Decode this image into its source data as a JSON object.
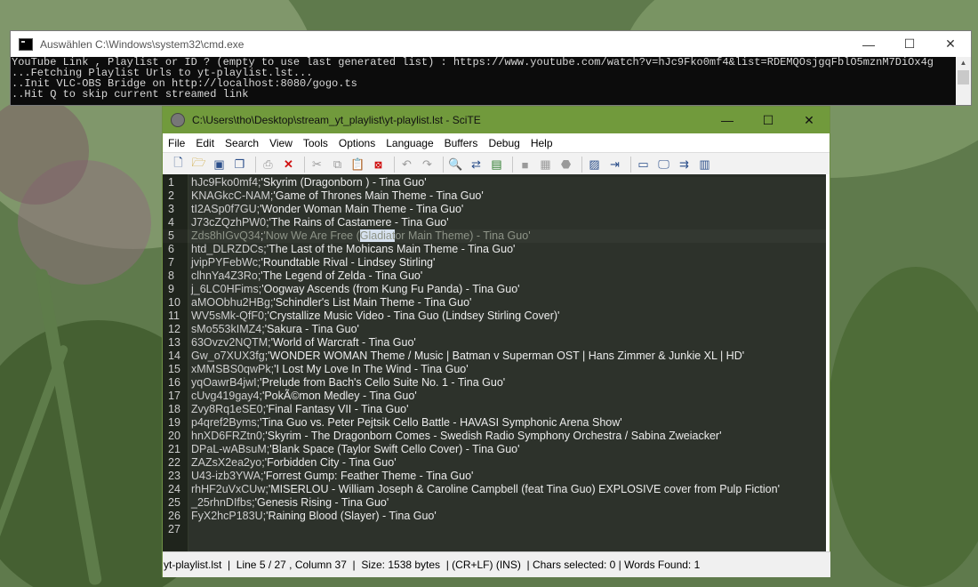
{
  "cmd": {
    "title": "Auswählen C:\\Windows\\system32\\cmd.exe",
    "lines": [
      "YouTube Link , Playlist or ID ? (empty to use last generated list) : https://www.youtube.com/watch?v=hJc9Fko0mf4&list=RDEMQOsjgqFblO5mznM7DiOx4g",
      "...Fetching Playlist Urls to yt-playlist.lst...",
      "..Init VLC-OBS Bridge on http://localhost:8080/gogo.ts",
      "..Hit Q to skip current streamed link"
    ],
    "minimize": "—",
    "maximize": "☐",
    "close": "✕"
  },
  "scite": {
    "title": "C:\\Users\\tho\\Desktop\\stream_yt_playlist\\yt-playlist.lst - SciTE",
    "minimize": "—",
    "maximize": "☐",
    "close": "✕",
    "menu": [
      "File",
      "Edit",
      "Search",
      "View",
      "Tools",
      "Options",
      "Language",
      "Buffers",
      "Debug",
      "Help"
    ],
    "lines": [
      {
        "n": "1",
        "id": "hJc9Fko0mf4",
        "title": "'Skyrim (Dragonborn ) - Tina Guo'"
      },
      {
        "n": "2",
        "id": "KNAGkcC-NAM",
        "title": "'Game of Thrones Main Theme - Tina Guo'"
      },
      {
        "n": "3",
        "id": "tI2ASp0f7GU",
        "title": "'Wonder Woman Main Theme - Tina Guo'"
      },
      {
        "n": "4",
        "id": "J73cZQzhPW0",
        "title": "'The Rains of Castamere - Tina Guo'"
      },
      {
        "n": "5",
        "id": "Zds8hIGvQ34",
        "title_a": "'Now We Are Free (",
        "title_sel": "Gladiat",
        "title_b": "or Main Theme) - Tina Guo'"
      },
      {
        "n": "6",
        "id": "htd_DLRZDCs",
        "title": "'The Last of the Mohicans Main Theme - Tina Guo'"
      },
      {
        "n": "7",
        "id": "jvipPYFebWc",
        "title": "'Roundtable Rival - Lindsey Stirling'"
      },
      {
        "n": "8",
        "id": "clhnYa4Z3Ro",
        "title": "'The Legend of Zelda - Tina Guo'"
      },
      {
        "n": "9",
        "id": "j_6LC0HFims",
        "title": "'Oogway Ascends (from Kung Fu Panda) - Tina Guo'"
      },
      {
        "n": "10",
        "id": "aMOObhu2HBg",
        "title": "'Schindler's List Main Theme - Tina Guo'"
      },
      {
        "n": "11",
        "id": "WV5sMk-QfF0",
        "title": "'Crystallize Music Video - Tina Guo (Lindsey Stirling Cover)'"
      },
      {
        "n": "12",
        "id": "sMo553kIMZ4",
        "title": "'Sakura - Tina Guo'"
      },
      {
        "n": "13",
        "id": "63Ovzv2NQTM",
        "title": "'World of Warcraft - Tina Guo'"
      },
      {
        "n": "14",
        "id": "Gw_o7XUX3fg",
        "title": "'WONDER WOMAN Theme / Music | Batman v Superman OST | Hans Zimmer & Junkie XL | HD'"
      },
      {
        "n": "15",
        "id": "xMMSBS0qwPk",
        "title": "'I Lost My Love In The Wind - Tina Guo'"
      },
      {
        "n": "16",
        "id": "yqOawrB4jwI",
        "title": "'Prelude from Bach's Cello Suite No. 1 - Tina Guo'"
      },
      {
        "n": "17",
        "id": "cUvg419gay4",
        "title": "'PokÃ©mon Medley - Tina Guo'"
      },
      {
        "n": "18",
        "id": "Zvy8Rq1eSE0",
        "title": "'Final Fantasy VII - Tina Guo'"
      },
      {
        "n": "19",
        "id": "p4qref2Byms",
        "title": "'Tina Guo vs. Peter Pejtsik Cello Battle - HAVASI Symphonic Arena Show'"
      },
      {
        "n": "20",
        "id": "hnXD6FRZtn0",
        "title": "'Skyrim - The Dragonborn Comes - Swedish Radio Symphony Orchestra / Sabina Zweiacker'"
      },
      {
        "n": "21",
        "id": "DPaL-wABsuM",
        "title": "'Blank Space (Taylor Swift Cello Cover) - Tina Guo'"
      },
      {
        "n": "22",
        "id": "ZAZsX2ea2yo",
        "title": "'Forbidden City - Tina Guo'"
      },
      {
        "n": "23",
        "id": "U43-izb3YWA",
        "title": "'Forrest Gump: Feather Theme - Tina Guo'"
      },
      {
        "n": "24",
        "id": "rhHF2uVxCUw",
        "title": "'MISERLOU - William Joseph & Caroline Campbell (feat Tina Guo) EXPLOSIVE cover from Pulp Fiction'"
      },
      {
        "n": "25",
        "id": "_25rhnDIfbs",
        "title": "'Genesis Rising - Tina Guo'"
      },
      {
        "n": "26",
        "id": "FyX2hcP183U",
        "title": "'Raining Blood (Slayer) - Tina Guo'"
      },
      {
        "n": "27",
        "id": "",
        "title": ""
      }
    ],
    "status": "yt-playlist.lst  |  Line 5 / 27 , Column 37  |  Size: 1538 bytes  | (CR+LF) (INS)  | Chars selected: 0 | Words Found: 1"
  }
}
